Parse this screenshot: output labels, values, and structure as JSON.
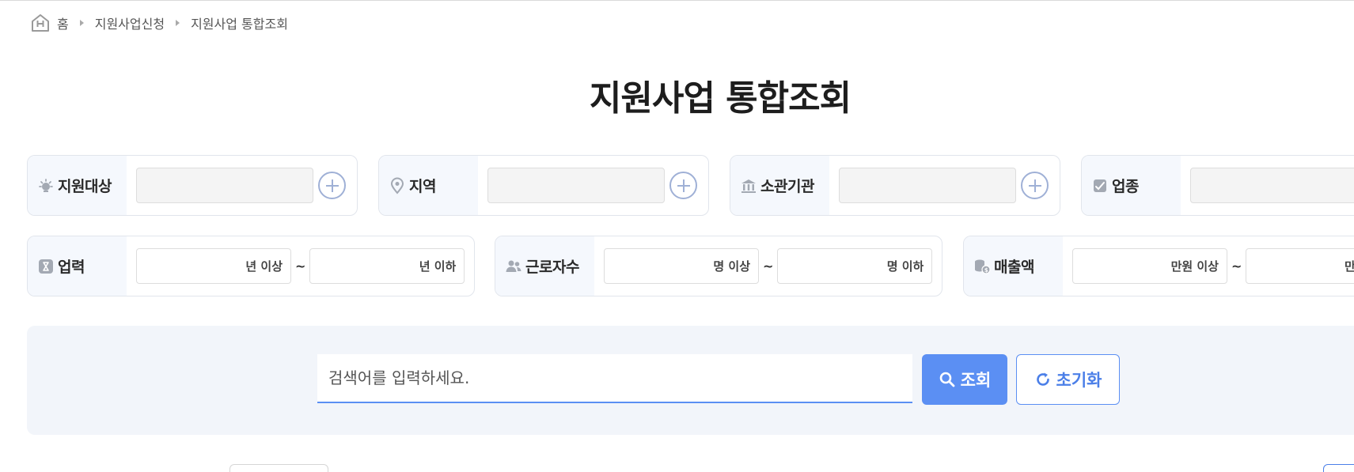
{
  "breadcrumb": {
    "home": "홈",
    "level1": "지원사업신청",
    "level2": "지원사업 통합조회"
  },
  "page_title": "지원사업 통합조회",
  "filters_row1": [
    {
      "key": "target",
      "label": "지원대상",
      "icon": "lightbulb-icon"
    },
    {
      "key": "region",
      "label": "지역",
      "icon": "location-pin-icon"
    },
    {
      "key": "agency",
      "label": "소관기관",
      "icon": "institution-icon"
    },
    {
      "key": "industry",
      "label": "업종",
      "icon": "industry-card-icon"
    }
  ],
  "filters_row2": {
    "years": {
      "label": "업력",
      "icon": "hourglass-icon",
      "min_placeholder": "년 이상",
      "max_placeholder": "년 이하"
    },
    "workers": {
      "label": "근로자수",
      "icon": "people-icon",
      "min_placeholder": "명 이상",
      "max_placeholder": "명 이하"
    },
    "sales": {
      "label": "매출액",
      "icon": "coins-icon",
      "min_placeholder": "만원 이상",
      "max_placeholder": "만원 이하"
    }
  },
  "range_separator": "~",
  "search": {
    "placeholder": "검색어를 입력하세요.",
    "search_label": "조회",
    "reset_label": "초기화"
  },
  "colors": {
    "accent": "#5b8ff3",
    "label_bg": "#f5f8fd",
    "panel_bg": "#f2f5fa",
    "plus": "#9fb0d6"
  }
}
